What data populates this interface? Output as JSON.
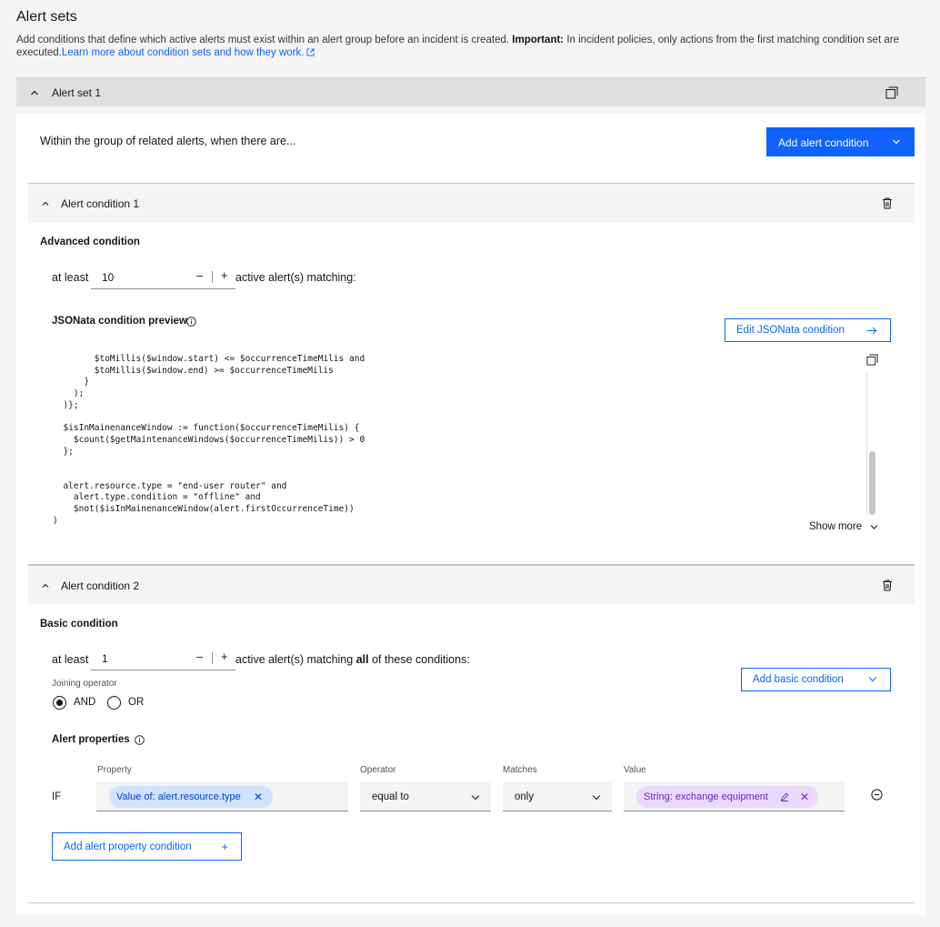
{
  "page": {
    "title": "Alert sets",
    "description_start": "Add conditions that define which active alerts must exist within an alert group before an incident is created.",
    "description_important": "Important:",
    "description_rest": "In incident policies, only actions from the first matching condition set are executed.",
    "learn_more_link": "Learn more about condition sets and how they work."
  },
  "alert_set": {
    "title": "Alert set 1",
    "within_text": "Within the group of related alerts, when there are...",
    "add_alert_condition_label": "Add alert condition"
  },
  "condition1": {
    "title": "Alert condition 1",
    "type_label": "Advanced condition",
    "at_least_label": "at least",
    "count": "10",
    "minus": "–",
    "plus": "+",
    "matching_label": "active alert(s) matching:",
    "jsonata_label": "JSONata condition preview",
    "edit_label": "Edit JSONata condition",
    "code": "        $toMillis($window.start) <= $occurrenceTimeMilis and\n        $toMillis($window.end) >= $occurrenceTimeMilis\n      }\n    );\n  )};\n\n  $isInMainenanceWindow := function($occurrenceTimeMilis) {\n    $count($getMaintenanceWindows($occurrenceTimeMilis)) > 0\n  };\n\n\n  alert.resource.type = \"end-user router\" and\n    alert.type.condition = \"offline\" and\n    $not($isInMainenanceWindow(alert.firstOccurrenceTime))\n)",
    "show_more_label": "Show more"
  },
  "condition2": {
    "title": "Alert condition 2",
    "type_label": "Basic condition",
    "at_least_label": "at least",
    "count": "1",
    "minus": "–",
    "plus": "+",
    "matching_label_start": "active alert(s) matching",
    "matching_label_all": "all",
    "matching_label_end": "of these conditions:",
    "add_basic_label": "Add basic condition",
    "joining_operator_label": "Joining operator",
    "and_label": "AND",
    "or_label": "OR",
    "selected_operator": "AND",
    "alert_properties_label": "Alert properties",
    "columns": {
      "property": "Property",
      "operator": "Operator",
      "matches": "Matches",
      "value": "Value"
    },
    "row": {
      "if_label": "IF",
      "property_tag": "Value of: alert.resource.type",
      "operator": "equal to",
      "matches": "only",
      "value_tag": "String: exchange equipment"
    },
    "add_property_label": "Add alert property condition"
  },
  "colors": {
    "primary": "#0f62fe",
    "blue_tag_bg": "#d0e2ff",
    "purple_tag_bg": "#e8daff"
  }
}
